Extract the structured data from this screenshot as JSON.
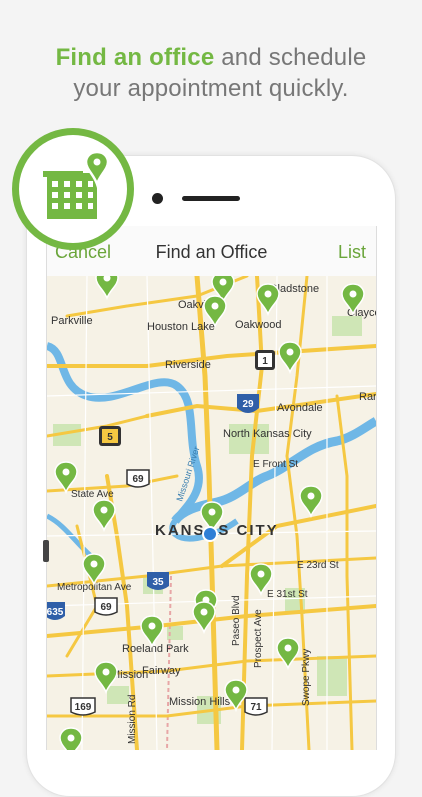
{
  "headline": {
    "highlight": "Find an office",
    "rest_line1": " and schedule",
    "line2": "your appointment quickly."
  },
  "navbar": {
    "cancel_label": "Cancel",
    "title": "Find an Office",
    "list_label": "List"
  },
  "map": {
    "place_labels": [
      {
        "text": "Gladstone",
        "kind": "place"
      },
      {
        "text": "Oakview",
        "kind": "place"
      },
      {
        "text": "Claycomo",
        "kind": "place"
      },
      {
        "text": "Parkville",
        "kind": "place"
      },
      {
        "text": "Houston Lake",
        "kind": "place"
      },
      {
        "text": "Oakwood",
        "kind": "place"
      },
      {
        "text": "Riverside",
        "kind": "place"
      },
      {
        "text": "Avondale",
        "kind": "place"
      },
      {
        "text": "Randolph",
        "kind": "place"
      },
      {
        "text": "North Kansas City",
        "kind": "place"
      },
      {
        "text": "E Front St",
        "kind": "street"
      },
      {
        "text": "Missouri River",
        "kind": "water"
      },
      {
        "text": "State Ave",
        "kind": "street"
      },
      {
        "text": "KANSAS CITY",
        "kind": "city"
      },
      {
        "text": "E 23rd St",
        "kind": "street"
      },
      {
        "text": "Metropolitan Ave",
        "kind": "street"
      },
      {
        "text": "E 31st St",
        "kind": "street"
      },
      {
        "text": "Paseo Blvd",
        "kind": "street"
      },
      {
        "text": "Prospect Ave",
        "kind": "street"
      },
      {
        "text": "Roeland Park",
        "kind": "place"
      },
      {
        "text": "Fairway",
        "kind": "place"
      },
      {
        "text": "Mission",
        "kind": "place"
      },
      {
        "text": "Swope Pkwy",
        "kind": "street"
      },
      {
        "text": "Mission Hills",
        "kind": "place"
      },
      {
        "text": "Mission Rd",
        "kind": "street"
      }
    ],
    "shields": [
      "1",
      "29",
      "5",
      "69",
      "35",
      "69",
      "635",
      "169",
      "71"
    ],
    "colors": {
      "land": "#f6f2e6",
      "road": "#f5c842",
      "water": "#6fb7e6",
      "park": "#cfe6b6",
      "pin": "#74b843",
      "user_dot": "#2f7fd6"
    }
  },
  "badge": {
    "icon": "office-building-pin-icon"
  }
}
